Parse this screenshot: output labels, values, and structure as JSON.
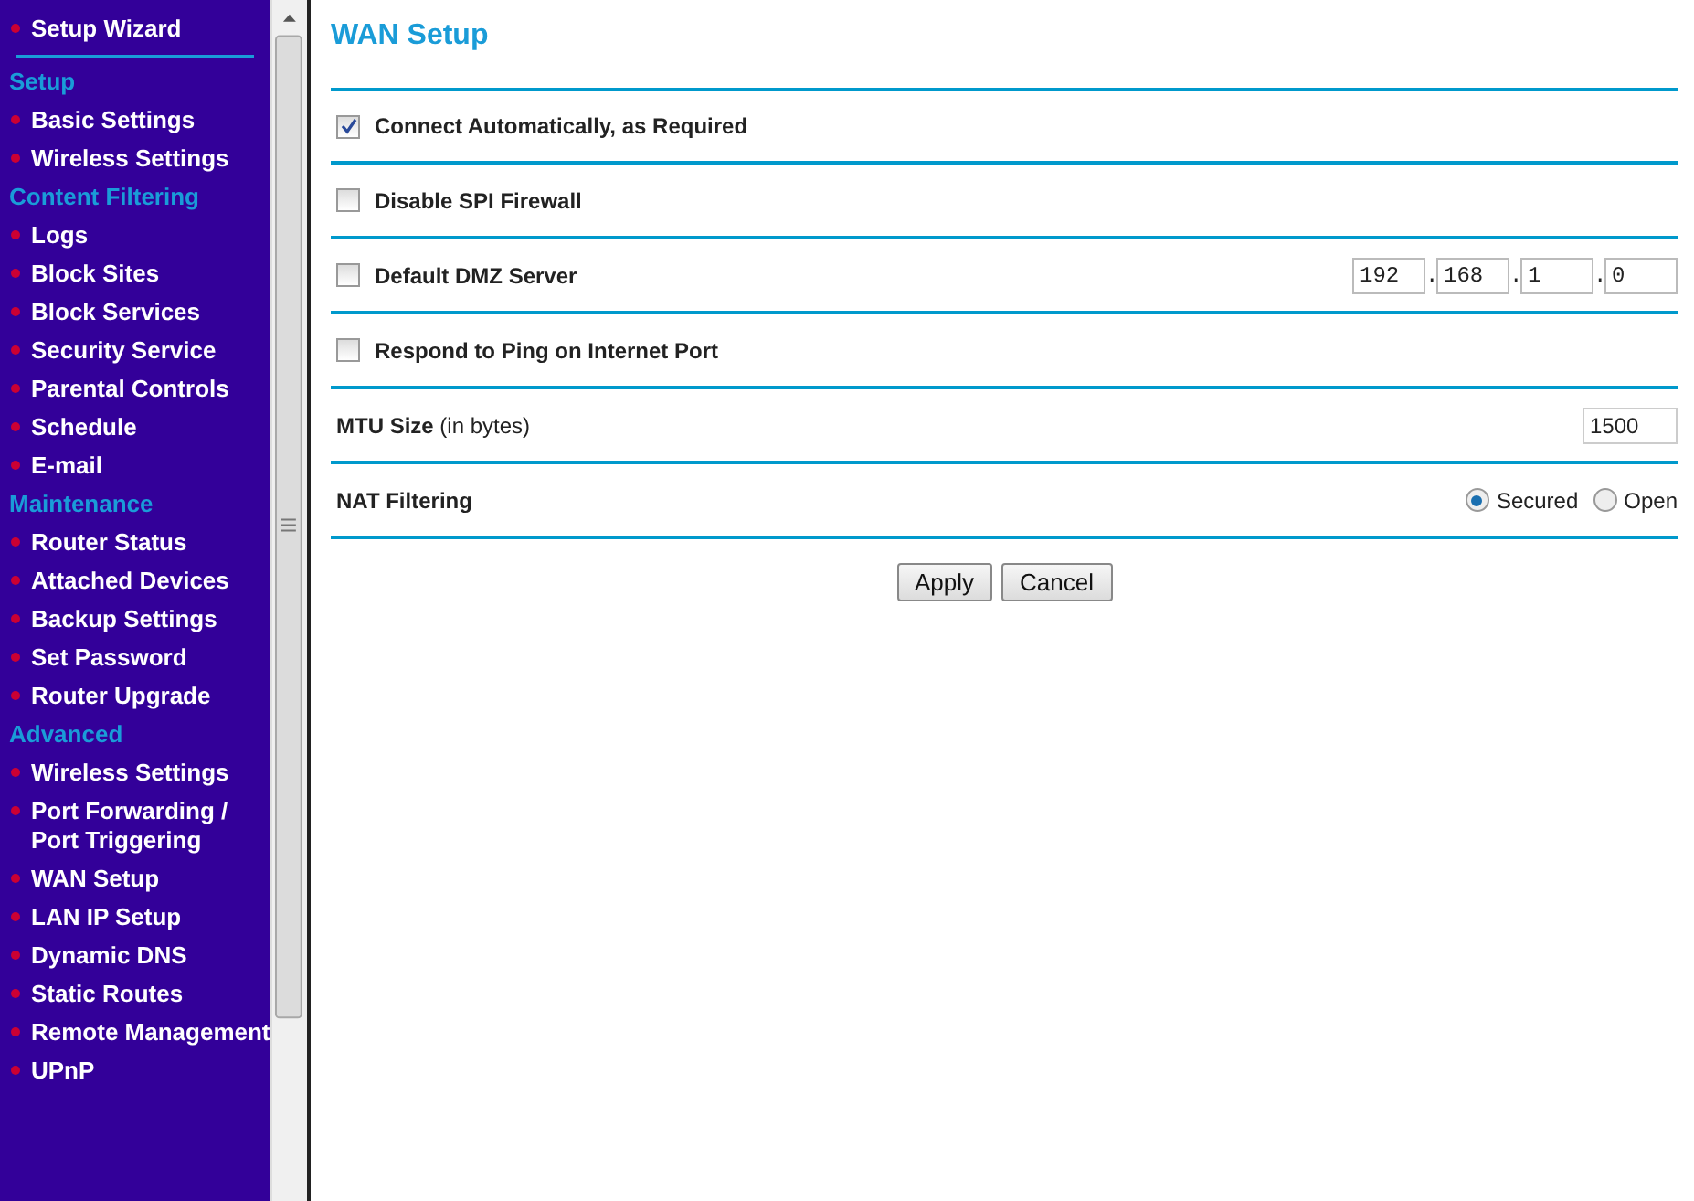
{
  "sidebar": {
    "items": [
      {
        "kind": "link",
        "label": "Setup Wizard"
      },
      {
        "kind": "rule"
      },
      {
        "kind": "heading",
        "label": "Setup"
      },
      {
        "kind": "link",
        "label": "Basic Settings"
      },
      {
        "kind": "link",
        "label": "Wireless Settings"
      },
      {
        "kind": "heading",
        "label": "Content Filtering"
      },
      {
        "kind": "link",
        "label": "Logs"
      },
      {
        "kind": "link",
        "label": "Block Sites"
      },
      {
        "kind": "link",
        "label": "Block Services"
      },
      {
        "kind": "link",
        "label": "Security Service"
      },
      {
        "kind": "link",
        "label": "Parental Controls"
      },
      {
        "kind": "link",
        "label": "Schedule"
      },
      {
        "kind": "link",
        "label": "E-mail"
      },
      {
        "kind": "heading",
        "label": "Maintenance"
      },
      {
        "kind": "link",
        "label": "Router Status"
      },
      {
        "kind": "link",
        "label": "Attached Devices"
      },
      {
        "kind": "link",
        "label": "Backup Settings"
      },
      {
        "kind": "link",
        "label": "Set Password"
      },
      {
        "kind": "link",
        "label": "Router Upgrade"
      },
      {
        "kind": "heading",
        "label": "Advanced"
      },
      {
        "kind": "link",
        "label": "Wireless Settings"
      },
      {
        "kind": "link",
        "label": "Port Forwarding / Port Triggering"
      },
      {
        "kind": "link",
        "label": "WAN Setup"
      },
      {
        "kind": "link",
        "label": "LAN IP Setup"
      },
      {
        "kind": "link",
        "label": "Dynamic DNS"
      },
      {
        "kind": "link",
        "label": "Static Routes"
      },
      {
        "kind": "link",
        "label": "Remote Management"
      },
      {
        "kind": "link",
        "label": "UPnP"
      }
    ]
  },
  "page": {
    "title": "WAN Setup",
    "rows": [
      {
        "kind": "checkbox",
        "label": "Connect Automatically, as Required",
        "checked": true
      },
      {
        "kind": "checkbox",
        "label": "Disable SPI Firewall",
        "checked": false
      },
      {
        "kind": "checkbox",
        "label": "Default DMZ Server",
        "checked": false,
        "ip": [
          "192",
          "168",
          "1",
          "0"
        ],
        "separators": [
          ".",
          ".",
          "."
        ]
      },
      {
        "kind": "checkbox",
        "label": "Respond to Ping on Internet Port",
        "checked": false
      },
      {
        "kind": "field",
        "label": "**MTU Size** (in bytes)",
        "value": "1500"
      },
      {
        "kind": "radio",
        "label": "NAT Filtering",
        "options": [
          {
            "label": "Secured",
            "selected": true
          },
          {
            "label": "Open",
            "selected": false
          }
        ]
      }
    ],
    "buttons": [
      "Apply",
      "Cancel"
    ]
  }
}
